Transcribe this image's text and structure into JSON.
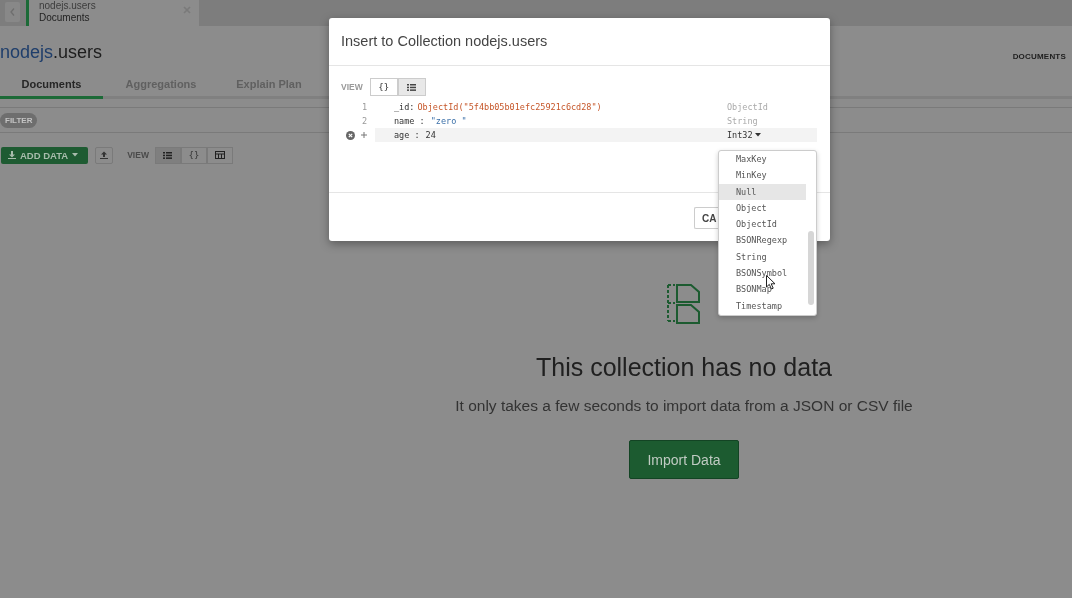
{
  "tab": {
    "title": "nodejs.users",
    "subtitle": "Documents"
  },
  "header": {
    "database": "nodejs",
    "collection": ".users"
  },
  "subtabs": [
    {
      "label": "Documents",
      "selected": true
    },
    {
      "label": "Aggregations",
      "selected": false
    },
    {
      "label": "Explain Plan",
      "selected": false
    }
  ],
  "filter_label": "FILTER",
  "toolbar": {
    "add_data": "ADD DATA",
    "view_label": "VIEW",
    "views": [
      {
        "kind": "list",
        "selected": true
      },
      {
        "kind": "json",
        "label": "{}",
        "selected": false
      },
      {
        "kind": "table",
        "selected": false
      }
    ]
  },
  "documents_label": "DOCUMENTS",
  "empty": {
    "title": "This collection has no data",
    "subtitle": "It only takes a few seconds to import data from a JSON or CSV file",
    "button": "Import Data"
  },
  "modal": {
    "title": "Insert to Collection nodejs.users",
    "view_label": "VIEW",
    "views": [
      {
        "kind": "json",
        "label": "{}",
        "selected": false
      },
      {
        "kind": "list",
        "selected": true
      }
    ],
    "fields": [
      {
        "line": "1",
        "key": "_id:",
        "value": "ObjectId(\"5f4bb05b01efc25921c6cd28\")",
        "kind": "objectid",
        "type": "ObjectId",
        "active": false
      },
      {
        "line": "2",
        "key": "name :",
        "value": "\"zero \"",
        "kind": "string",
        "type": "String",
        "active": false
      },
      {
        "key": "age :",
        "value": "24",
        "kind": "number",
        "type": "Int32",
        "active": true
      }
    ],
    "cancel": "CA",
    "type_menu": [
      {
        "label": "MaxKey",
        "selected": false
      },
      {
        "label": "MinKey",
        "selected": false
      },
      {
        "label": "Null",
        "selected": true
      },
      {
        "label": "Object",
        "selected": false
      },
      {
        "label": "ObjectId",
        "selected": false
      },
      {
        "label": "BSONRegexp",
        "selected": false
      },
      {
        "label": "String",
        "selected": false
      },
      {
        "label": "BSONSymbol",
        "selected": false
      },
      {
        "label": "BSONMap",
        "selected": false
      },
      {
        "label": "Timestamp",
        "selected": false
      }
    ]
  }
}
